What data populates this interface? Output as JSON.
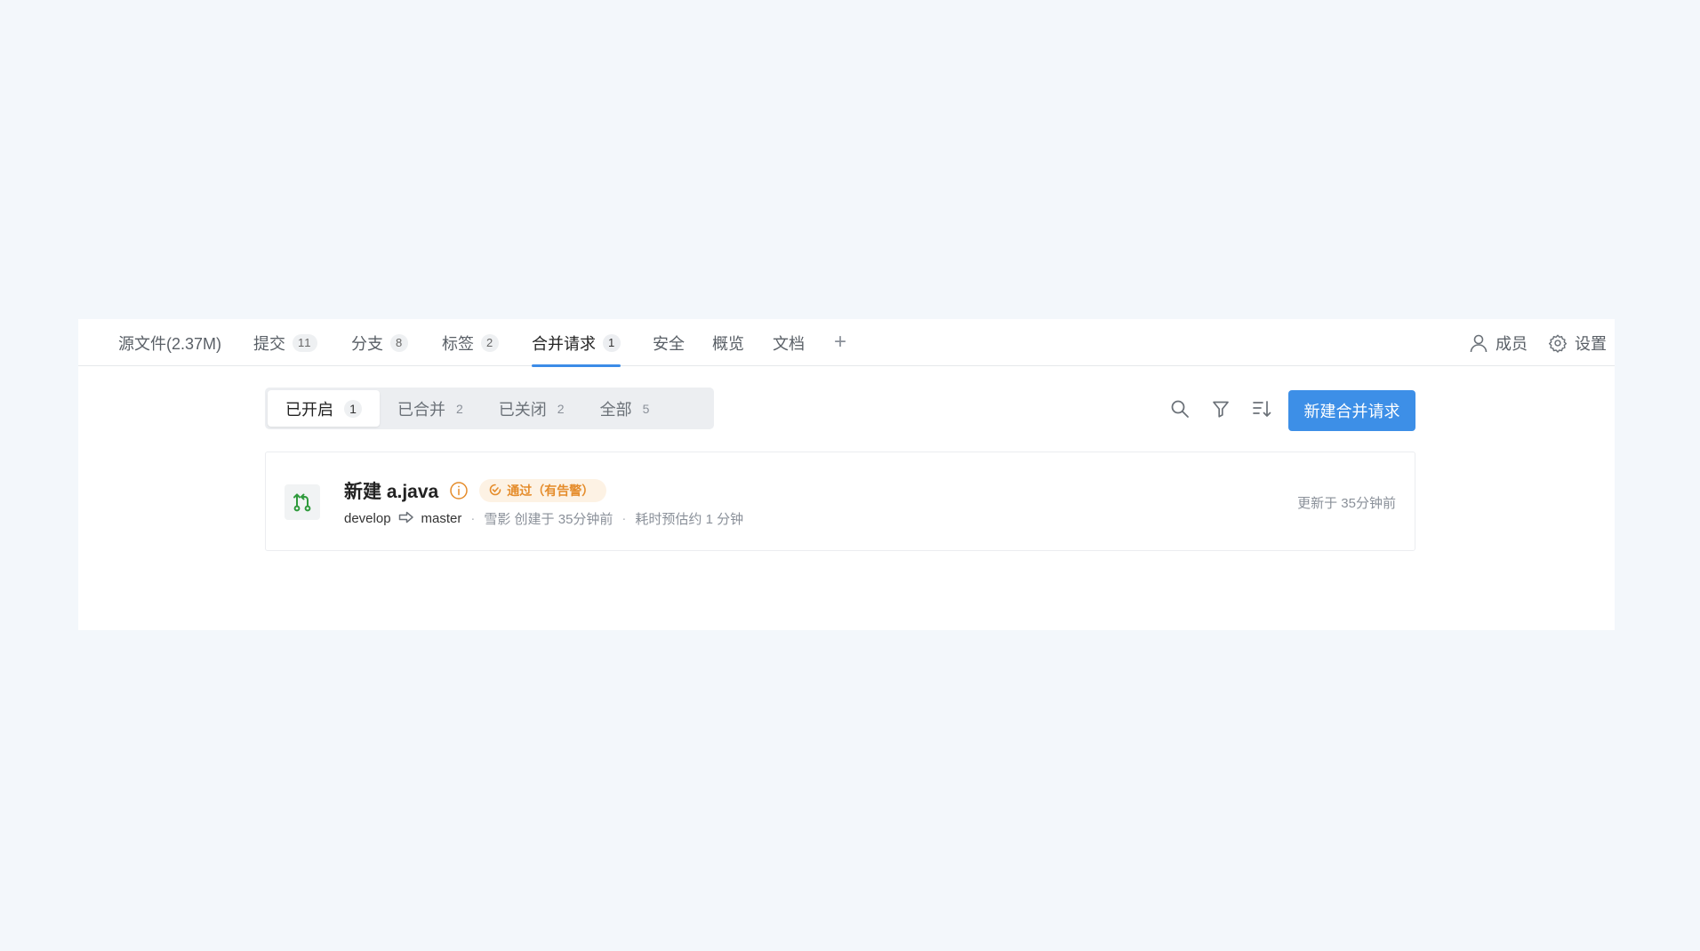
{
  "nav": {
    "tabs": [
      {
        "label": "源文件(2.37M)",
        "count": ""
      },
      {
        "label": "提交",
        "count": "11"
      },
      {
        "label": "分支",
        "count": "8"
      },
      {
        "label": "标签",
        "count": "2"
      },
      {
        "label": "合并请求",
        "count": "1",
        "active": true
      },
      {
        "label": "安全",
        "count": ""
      },
      {
        "label": "概览",
        "count": ""
      },
      {
        "label": "文档",
        "count": ""
      }
    ],
    "add_label": "+",
    "members_label": "成员",
    "settings_label": "设置"
  },
  "filters": {
    "items": [
      {
        "label": "已开启",
        "count": "1",
        "active": true
      },
      {
        "label": "已合并",
        "count": "2"
      },
      {
        "label": "已关闭",
        "count": "2"
      },
      {
        "label": "全部",
        "count": "5"
      }
    ]
  },
  "toolbar": {
    "new_mr_label": "新建合并请求",
    "icons": [
      "search-icon",
      "filter-icon",
      "sort-icon"
    ]
  },
  "merge_requests": [
    {
      "title": "新建 a.java",
      "status": "通过（有告警）",
      "source_branch": "develop",
      "target_branch": "master",
      "author_created": "雪影 创建于 35分钟前",
      "estimate": "耗时预估约 1 分钟",
      "updated": "更新于 35分钟前"
    }
  ],
  "colors": {
    "accent": "#3d8fe7",
    "warning": "#e58c2b",
    "warning_bg": "#fdf2e4",
    "mr_icon": "#2f9a3c",
    "background": "#f3f7fb"
  }
}
